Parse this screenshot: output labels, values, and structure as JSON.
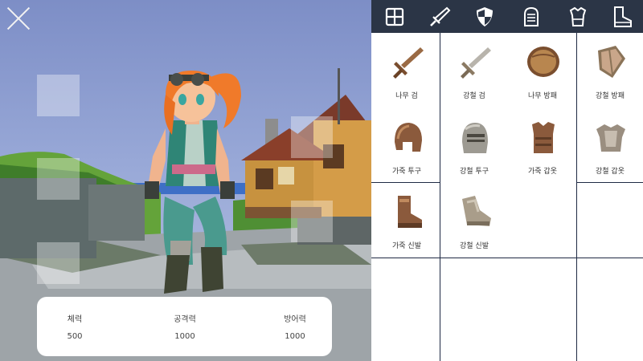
{
  "stats": [
    {
      "label": "체력",
      "value": "500"
    },
    {
      "label": "공격력",
      "value": "1000"
    },
    {
      "label": "방어력",
      "value": "1000"
    }
  ],
  "tabs": [
    {
      "icon": "grid-icon"
    },
    {
      "icon": "sword-icon"
    },
    {
      "icon": "shield-icon"
    },
    {
      "icon": "helmet-icon"
    },
    {
      "icon": "armor-icon"
    },
    {
      "icon": "boots-icon"
    }
  ],
  "items": [
    {
      "name": "나무 검",
      "icon": "wooden-sword-icon"
    },
    {
      "name": "강철 검",
      "icon": "steel-sword-icon"
    },
    {
      "name": "나무 방패",
      "icon": "wooden-shield-icon"
    },
    {
      "name": "강철 방패",
      "icon": "steel-shield-icon"
    },
    {
      "name": "가죽 투구",
      "icon": "leather-helmet-icon"
    },
    {
      "name": "강철 투구",
      "icon": "steel-helmet-icon"
    },
    {
      "name": "가죽 갑옷",
      "icon": "leather-armor-icon"
    },
    {
      "name": "강철 갑옷",
      "icon": "steel-armor-icon"
    },
    {
      "name": "가죽 신발",
      "icon": "leather-boots-icon"
    },
    {
      "name": "강철 신발",
      "icon": "steel-boots-icon"
    }
  ],
  "colors": {
    "header": "#2b3546",
    "panel": "#ffffff",
    "grid_line": "#1f2a44",
    "leather": "#8b5a3c",
    "steel": "#a9a296"
  }
}
